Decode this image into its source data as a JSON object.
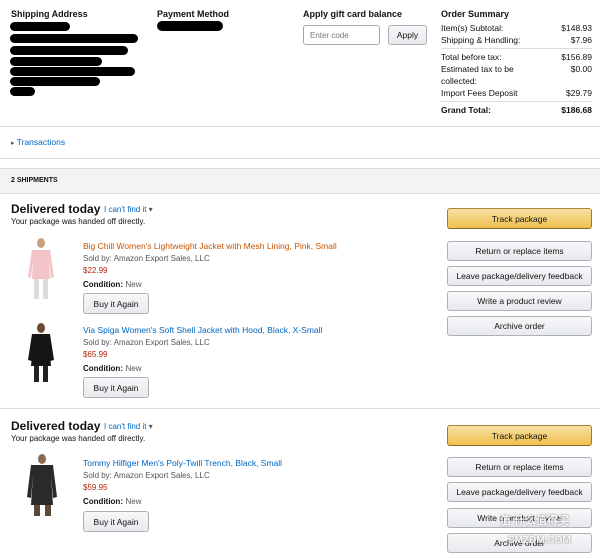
{
  "address": {
    "title": "Shipping Address"
  },
  "payment": {
    "title": "Payment Method"
  },
  "gift_card": {
    "title": "Apply gift card balance",
    "placeholder": "Enter code",
    "apply_label": "Apply"
  },
  "summary": {
    "title": "Order Summary",
    "rows": [
      {
        "label": "Item(s) Subtotal:",
        "value": "$148.93"
      },
      {
        "label": "Shipping & Handling:",
        "value": "$7.96"
      },
      {
        "label": "Total before tax:",
        "value": "$156.89"
      },
      {
        "label": "Estimated tax to be",
        "value": "$0.00"
      },
      {
        "label": "collected:",
        "value": ""
      },
      {
        "label": "Import Fees Deposit",
        "value": "$29.79"
      }
    ],
    "grand_label": "Grand Total:",
    "grand_value": "$186.68"
  },
  "transactions": {
    "arrow": "▸",
    "label": "Transactions"
  },
  "shipments_header": "2 SHIPMENTS",
  "shipments": [
    {
      "status": "Delivered today",
      "cant_find": "I can't find it",
      "caret": "▾",
      "substatus": "Your package was handed off directly.",
      "items": [
        {
          "title": "Big Chill Women's Lightweight Jacket with Mesh Lining, Pink, Small",
          "seller": "Sold by: Amazon Export Sales, LLC",
          "price": "$22.99",
          "condition_label": "Condition:",
          "condition_value": "New",
          "buy_again": "Buy it Again"
        },
        {
          "title": "Via Spiga Women's Soft Shell Jacket with Hood, Black, X-Small",
          "seller": "Sold by: Amazon Export Sales, LLC",
          "price": "$65.99",
          "condition_label": "Condition:",
          "condition_value": "New",
          "buy_again": "Buy it Again"
        }
      ],
      "actions": {
        "track": "Track package",
        "return": "Return or replace items",
        "leave_feedback": "Leave package/delivery feedback",
        "review": "Write a product review",
        "archive": "Archive order"
      }
    },
    {
      "status": "Delivered today",
      "cant_find": "I can't find it",
      "caret": "▾",
      "substatus": "Your package was handed off directly.",
      "items": [
        {
          "title": "Tommy Hilfiger Men's Poly-Twill Trench, Black, Small",
          "seller": "Sold by: Amazon Export Sales, LLC",
          "price": "$59.95",
          "condition_label": "Condition:",
          "condition_value": "New",
          "buy_again": "Buy it Again"
        }
      ],
      "actions": {
        "track": "Track package",
        "return": "Return or replace items",
        "leave_feedback": "Leave package/delivery feedback",
        "review": "Write a product review",
        "archive": "Archive order"
      }
    }
  ],
  "watermark": {
    "line1": "值 什么值得买",
    "line2": "SMZDM.COM"
  },
  "colors": {
    "link": "#0066c0",
    "title_orange": "#c45500",
    "price": "#b12704",
    "primary_button": "#f0c14b"
  }
}
